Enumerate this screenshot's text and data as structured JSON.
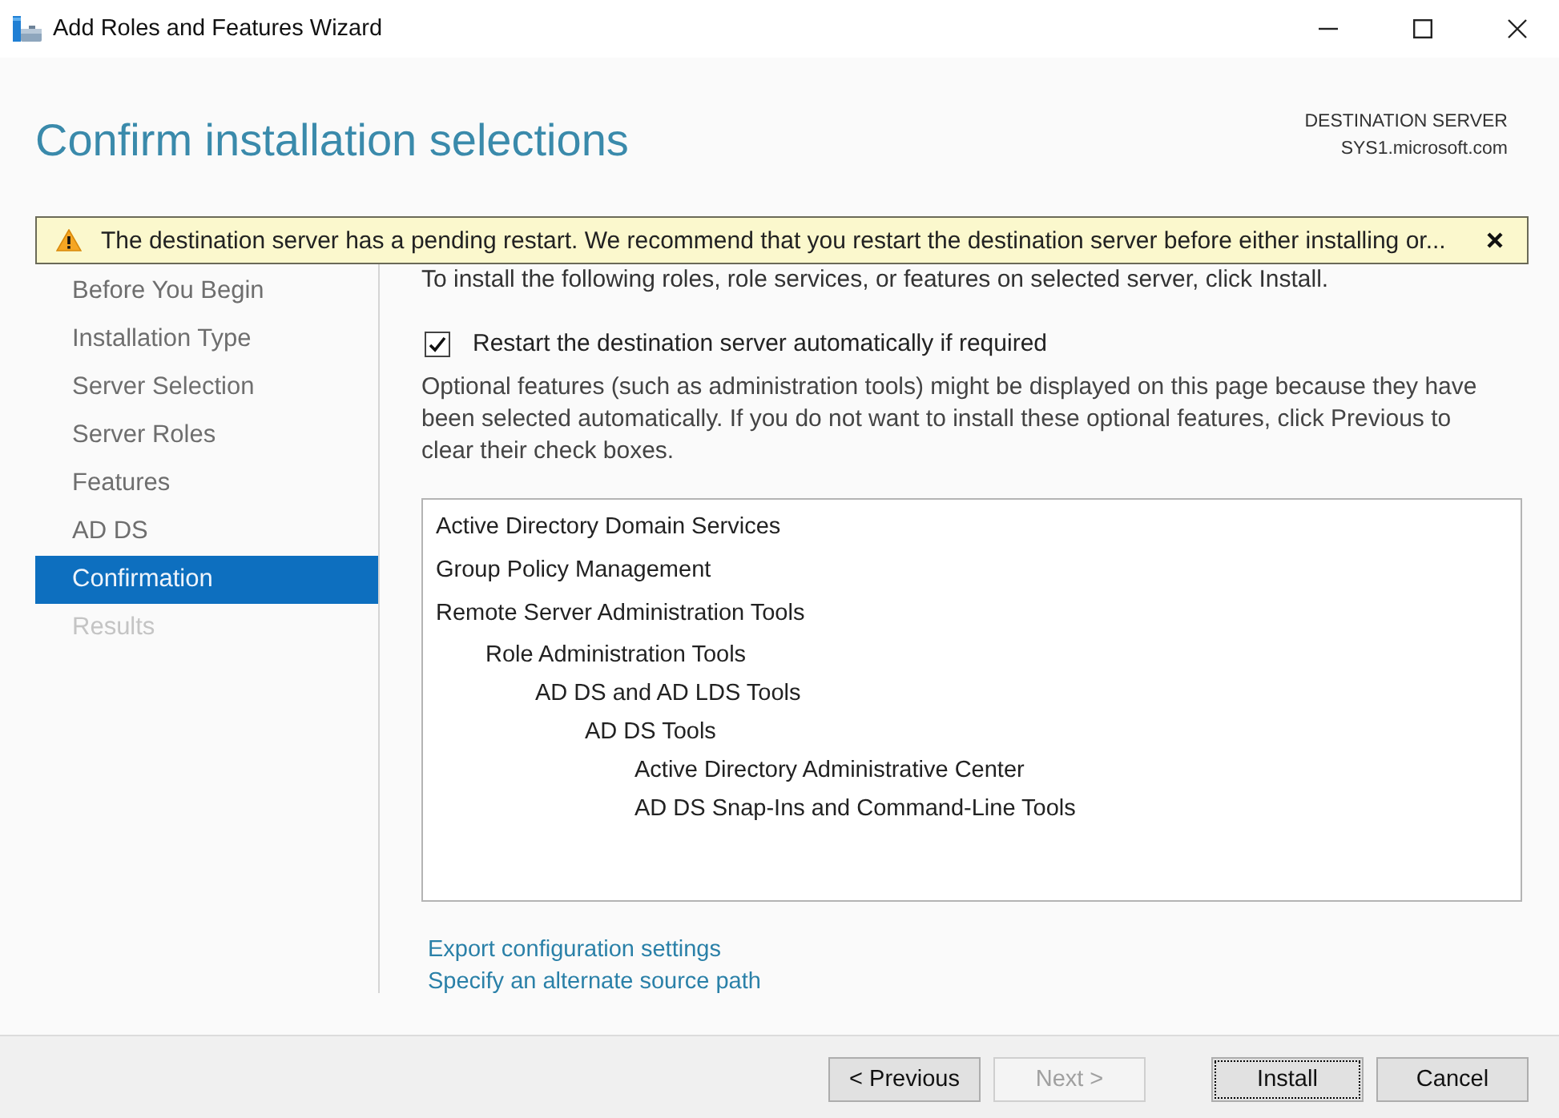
{
  "window": {
    "title": "Add Roles and Features Wizard"
  },
  "header": {
    "title": "Confirm installation selections",
    "destination_label": "DESTINATION SERVER",
    "destination_server": "SYS1.microsoft.com"
  },
  "warning": {
    "text": "The destination server has a pending restart. We recommend that you restart the destination server before either installing or..."
  },
  "steps": [
    {
      "label": "Before You Begin",
      "selected": false,
      "disabled": false
    },
    {
      "label": "Installation Type",
      "selected": false,
      "disabled": false
    },
    {
      "label": "Server Selection",
      "selected": false,
      "disabled": false
    },
    {
      "label": "Server Roles",
      "selected": false,
      "disabled": false
    },
    {
      "label": "Features",
      "selected": false,
      "disabled": false
    },
    {
      "label": "AD DS",
      "selected": false,
      "disabled": false
    },
    {
      "label": "Confirmation",
      "selected": true,
      "disabled": false
    },
    {
      "label": "Results",
      "selected": false,
      "disabled": true
    }
  ],
  "content": {
    "intro": "To install the following roles, role services, or features on selected server, click Install.",
    "restart_option": {
      "label": "Restart the destination server automatically if required",
      "checked": true
    },
    "note": "Optional features (such as administration tools) might be displayed on this page because they have been selected automatically. If you do not want to install these optional features, click Previous to clear their check boxes.",
    "selections": [
      {
        "label": "Active Directory Domain Services"
      },
      {
        "label": "Group Policy Management"
      },
      {
        "label": "Remote Server Administration Tools",
        "children": [
          {
            "label": "Role Administration Tools",
            "children": [
              {
                "label": "AD DS and AD LDS Tools",
                "children": [
                  {
                    "label": "AD DS Tools",
                    "children": [
                      {
                        "label": "Active Directory Administrative Center"
                      },
                      {
                        "label": "AD DS Snap-Ins and Command-Line Tools"
                      }
                    ]
                  }
                ]
              }
            ]
          }
        ]
      }
    ],
    "links": [
      "Export configuration settings",
      "Specify an alternate source path"
    ]
  },
  "buttons": [
    {
      "label": "< Previous",
      "disabled": false,
      "focused": false
    },
    {
      "label": "Next >",
      "disabled": true,
      "focused": false
    },
    {
      "label": "Install",
      "disabled": false,
      "focused": true
    },
    {
      "label": "Cancel",
      "disabled": false,
      "focused": false
    }
  ]
}
